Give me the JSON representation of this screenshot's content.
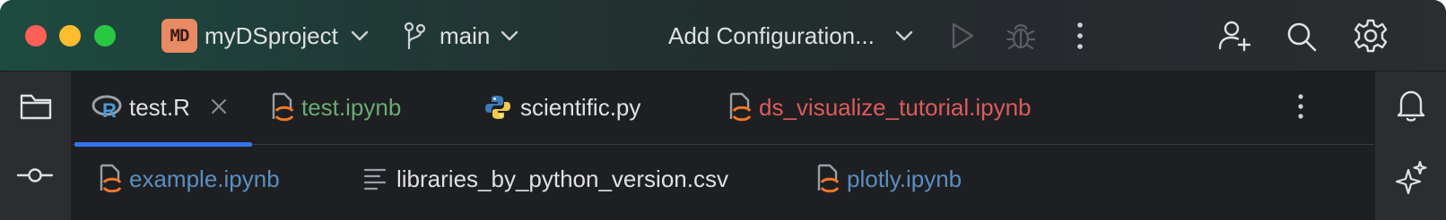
{
  "titlebar": {
    "project_badge": "MD",
    "project_name": "myDSproject",
    "branch": "main",
    "run_configuration": "Add Configuration..."
  },
  "tabs_row1": [
    {
      "label": "test.R",
      "icon": "r-lang-icon",
      "color": "#dfe1e5",
      "active": true,
      "closable": true
    },
    {
      "label": "test.ipynb",
      "icon": "jupyter-notebook-icon",
      "color": "#6aab73"
    },
    {
      "label": "scientific.py",
      "icon": "python-icon",
      "color": "#dfe1e5"
    },
    {
      "label": "ds_visualize_tutorial.ipynb",
      "icon": "jupyter-notebook-icon",
      "color": "#db5c5c"
    }
  ],
  "tabs_row2": [
    {
      "label": "example.ipynb",
      "icon": "jupyter-notebook-icon",
      "color": "#5a8fbf"
    },
    {
      "label": "libraries_by_python_version.csv",
      "icon": "text-lines-icon",
      "color": "#dfe1e5"
    },
    {
      "label": "plotly.ipynb",
      "icon": "jupyter-notebook-icon",
      "color": "#5a8fbf"
    }
  ],
  "colors": {
    "accent": "#3574f0",
    "traffic_close": "#fe5f57",
    "traffic_minimize": "#febc2e",
    "traffic_maximize": "#28c840"
  }
}
